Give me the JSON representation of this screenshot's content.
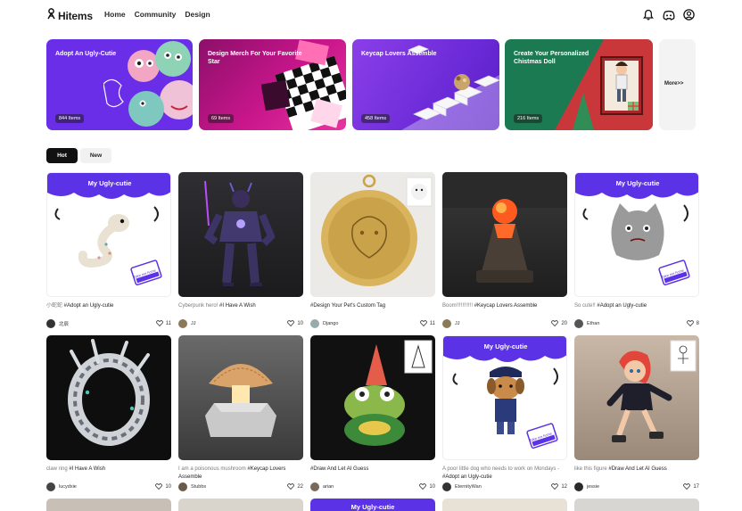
{
  "nav": {
    "logo": "Hitems",
    "links": [
      "Home",
      "Community",
      "Design"
    ]
  },
  "banners": [
    {
      "title": "Adopt An Ugly-Cutie",
      "count": "844 Items"
    },
    {
      "title": "Design Merch For Your Favorite Star",
      "count": "69 Items"
    },
    {
      "title": "Keycap Lovers Assemble",
      "count": "458 Items"
    },
    {
      "title": "Create Your Personalized Chistmas Doll",
      "count": "216 Items"
    }
  ],
  "more_label": "More>>",
  "tabs": [
    "Hot",
    "New"
  ],
  "ugly_banner": "My Ugly-cutie",
  "tag_text": "Take me home",
  "cards": [
    {
      "grey": "小蛇蛇 ",
      "text": "#Adopt an Ugly-cutie",
      "user": "北辰",
      "likes": "11"
    },
    {
      "grey": "Cyberpunk hero! ",
      "text": "#I Have A Wish",
      "user": "JJ",
      "likes": "10"
    },
    {
      "grey": "",
      "text": "#Design Your Pet's Custom Tag",
      "user": "Django",
      "likes": "11"
    },
    {
      "grey": "Boom!!!!!!!!!!! ",
      "text": "#Keycap Lovers Assemble",
      "user": "JJ",
      "likes": "20"
    },
    {
      "grey": "So cute!! ",
      "text": "#Adopt an Ugly-cutie",
      "user": "Ethan",
      "likes": "8"
    },
    {
      "grey": "claw ring ",
      "text": "#I Have A Wish",
      "user": "lucydxie",
      "likes": "10"
    },
    {
      "grey": "I am a poisonous mushroom ",
      "text": "#Keycap Lovers Assemble",
      "user": "Stubbs",
      "likes": "22"
    },
    {
      "grey": "",
      "text": "#Draw And Let AI Guess",
      "user": "arian",
      "likes": "10"
    },
    {
      "grey": "A poor little dog who needs to work on Mondays - ",
      "text": "#Adopt an Ugly-cutie",
      "user": "EternityWan",
      "likes": "12"
    },
    {
      "grey": "like this figure ",
      "text": "#Draw And Let AI Guess",
      "user": "jessie",
      "likes": "17"
    }
  ]
}
